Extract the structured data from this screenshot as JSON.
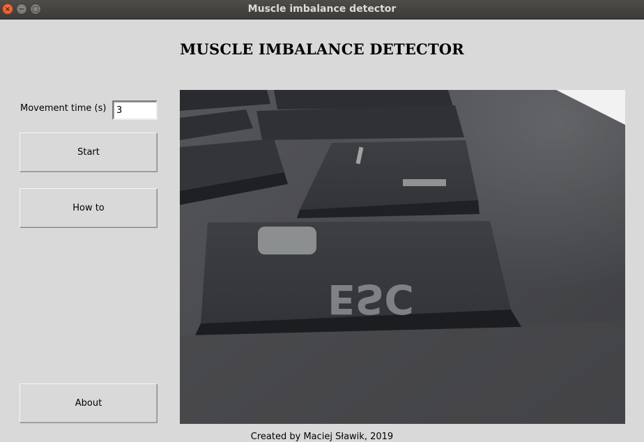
{
  "window": {
    "title": "Muscle imbalance detector",
    "controls": {
      "close_glyph": "×",
      "minimize_glyph": "−",
      "maximize_glyph": "□"
    }
  },
  "heading": "MUSCLE IMBALANCE DETECTOR",
  "form": {
    "movement_time_label": "Movement time (s)",
    "movement_time_value": "3"
  },
  "buttons": {
    "start": "Start",
    "how_to": "How to",
    "about": "About"
  },
  "camera": {
    "keycap_esc": "ESC"
  },
  "footer": "Created by Maciej Sławik, 2019"
}
